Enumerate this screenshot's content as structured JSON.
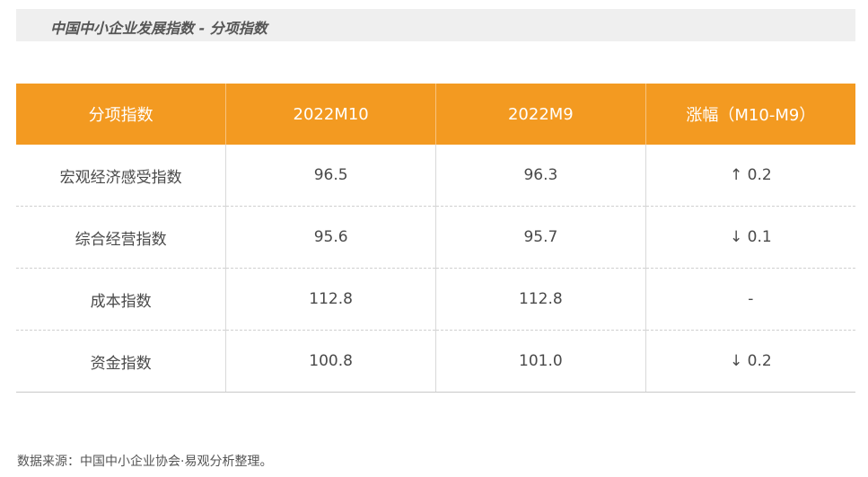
{
  "title": "中国中小企业发展指数 - 分项指数",
  "table": {
    "headers": [
      "分项指数",
      "2022M10",
      "2022M9",
      "涨幅（M10-M9）"
    ],
    "rows": [
      [
        "宏观经济感受指数",
        "96.5",
        "96.3",
        "↑  0.2"
      ],
      [
        "综合经营指数",
        "95.6",
        "95.7",
        "↓ 0.1"
      ],
      [
        "成本指数",
        "112.8",
        "112.8",
        "-"
      ],
      [
        "资金指数",
        "100.8",
        "101.0",
        "↓ 0.2"
      ]
    ]
  },
  "source": "数据来源：中国中小企业协会·易观分析整理。",
  "colors": {
    "header_bg": "#f39a21",
    "title_bar_bg": "#efefef"
  }
}
